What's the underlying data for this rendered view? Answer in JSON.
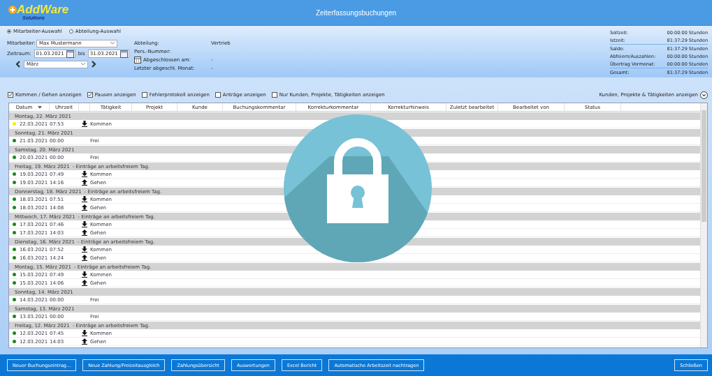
{
  "header": {
    "logo": {
      "name": "AddWare",
      "tagline": "Solutions"
    },
    "title": "Zeiterfassungsbuchungen"
  },
  "selection": {
    "modes": [
      {
        "label": "Mitarbeiter-Auswahl",
        "selected": true
      },
      {
        "label": "Abteilung-Auswahl",
        "selected": false
      }
    ],
    "employee": {
      "label": "Mitarbeiter:",
      "value": "Max Mustermann"
    },
    "period": {
      "label": "Zeitraum:",
      "from": "01.03.2021",
      "to_label": "bis",
      "to": "31.03.2021",
      "month": "März"
    },
    "info": [
      {
        "label": "Abteilung:",
        "value": "Vertrieb",
        "kind": "text"
      },
      {
        "label": "Pers.-Nummer:",
        "kind": "text"
      },
      {
        "label": "Abgeschlossen am:",
        "value": "-",
        "kind": "calendar"
      },
      {
        "label": "Letzter abgeschl. Monat:",
        "value": "-",
        "kind": "text"
      }
    ],
    "summary": [
      {
        "label": "Sollzeit:",
        "value": "00:00:00 Stunden",
        "rule_below": false
      },
      {
        "label": "Istzeit:",
        "value": "81:37:29 Stunden",
        "rule_below": true
      },
      {
        "label": "Saldo:",
        "value": "81:37:29 Stunden",
        "rule_below": false
      },
      {
        "label": "Abfeiern/Auszahlen:",
        "value": "00:00:00 Stunden",
        "rule_below": false
      },
      {
        "label": "Übertrag Vormonat:",
        "value": "00:00:00 Stunden",
        "rule_below": true
      },
      {
        "label": "Gesamt:",
        "value": "81:37:29 Stunden",
        "rule_below": false
      }
    ]
  },
  "options": [
    {
      "label": "Kommen / Gehen anzeigen",
      "checked": true
    },
    {
      "label": "Pausen anzeigen",
      "checked": true
    },
    {
      "label": "Fehlerprotokoll anzeigen",
      "checked": false
    },
    {
      "label": "Anträge anzeigen",
      "checked": false
    },
    {
      "label": "Nur Kunden, Projekte, Tätigkeiten anzeigen",
      "checked": false
    }
  ],
  "expand_toggle": "Kunden, Projekte & Tätigkeiten anzeigen",
  "table": {
    "columns": [
      "Datum",
      "Uhrzeit",
      "",
      "Tätigkeit",
      "Projekt",
      "Kunde",
      "Buchungskommentar",
      "Korrekturkommentar",
      "Korrekturhinweis",
      "Zuletzt bearbeitet",
      "Bearbeitet von",
      "Status"
    ],
    "groups": [
      {
        "title": "Montag, 22. März 2021",
        "entries": [
          {
            "date": "22.03.2021",
            "time": "07:53",
            "kind": "in",
            "activity": "Kommen",
            "color": "#f5f000"
          }
        ]
      },
      {
        "title": "Sonntag, 21. März 2021",
        "entries": [
          {
            "date": "21.03.2021",
            "time": "00:00",
            "kind": "none",
            "activity": "Frei",
            "color": "#1a8a1a"
          }
        ]
      },
      {
        "title": "Samstag, 20. März 2021",
        "entries": [
          {
            "date": "20.03.2021",
            "time": "00:00",
            "kind": "none",
            "activity": "Frei",
            "color": "#1a8a1a"
          }
        ]
      },
      {
        "title": "Freitag, 19. März 2021",
        "note": "- Einträge an arbeitsfreiem Tag.",
        "entries": [
          {
            "date": "19.03.2021",
            "time": "07:49",
            "kind": "in",
            "activity": "Kommen",
            "color": "#1a8a1a"
          },
          {
            "date": "19.03.2021",
            "time": "14:16",
            "kind": "out",
            "activity": "Gehen",
            "color": "#1a8a1a"
          }
        ]
      },
      {
        "title": "Donnerstag, 18. März 2021",
        "note": "- Einträge an arbeitsfreiem Tag.",
        "entries": [
          {
            "date": "18.03.2021",
            "time": "07:51",
            "kind": "in",
            "activity": "Kommen",
            "color": "#1a8a1a"
          },
          {
            "date": "18.03.2021",
            "time": "14:08",
            "kind": "out",
            "activity": "Gehen",
            "color": "#1a8a1a"
          }
        ]
      },
      {
        "title": "Mittwoch, 17. März 2021",
        "note": "- Einträge an arbeitsfreiem Tag.",
        "entries": [
          {
            "date": "17.03.2021",
            "time": "07:46",
            "kind": "in",
            "activity": "Kommen",
            "color": "#1a8a1a"
          },
          {
            "date": "17.03.2021",
            "time": "14:03",
            "kind": "out",
            "activity": "Gehen",
            "color": "#1a8a1a"
          }
        ]
      },
      {
        "title": "Dienstag, 16. März 2021",
        "note": "- Einträge an arbeitsfreiem Tag.",
        "entries": [
          {
            "date": "16.03.2021",
            "time": "07:52",
            "kind": "in",
            "activity": "Kommen",
            "color": "#1a8a1a"
          },
          {
            "date": "16.03.2021",
            "time": "14:24",
            "kind": "out",
            "activity": "Gehen",
            "color": "#1a8a1a"
          }
        ]
      },
      {
        "title": "Montag, 15. März 2021",
        "note": "- Einträge an arbeitsfreiem Tag.",
        "entries": [
          {
            "date": "15.03.2021",
            "time": "07:49",
            "kind": "in",
            "activity": "Kommen",
            "color": "#1a8a1a"
          },
          {
            "date": "15.03.2021",
            "time": "14:06",
            "kind": "out",
            "activity": "Gehen",
            "color": "#1a8a1a"
          }
        ]
      },
      {
        "title": "Sonntag, 14. März 2021",
        "entries": [
          {
            "date": "14.03.2021",
            "time": "00:00",
            "kind": "none",
            "activity": "Frei",
            "color": "#1a8a1a"
          }
        ]
      },
      {
        "title": "Samstag, 13. März 2021",
        "entries": [
          {
            "date": "13.03.2021",
            "time": "00:00",
            "kind": "none",
            "activity": "Frei",
            "color": "#1a8a1a"
          }
        ]
      },
      {
        "title": "Freitag, 12. März 2021",
        "note": "- Einträge an arbeitsfreiem Tag.",
        "entries": [
          {
            "date": "12.03.2021",
            "time": "07:45",
            "kind": "in",
            "activity": "Kommen",
            "color": "#1a8a1a"
          },
          {
            "date": "12.03.2021",
            "time": "14:03",
            "kind": "out",
            "activity": "Gehen",
            "color": "#1a8a1a"
          }
        ]
      }
    ]
  },
  "buttons": [
    "Neuer Buchungseintrag...",
    "Neue Zahlung/Freizeitausgleich",
    "Zahlungsübersicht",
    "Auswertungen",
    "Excel Bericht",
    "Automatische Arbeitszeit nachtragen"
  ],
  "close_button": "Schließen"
}
